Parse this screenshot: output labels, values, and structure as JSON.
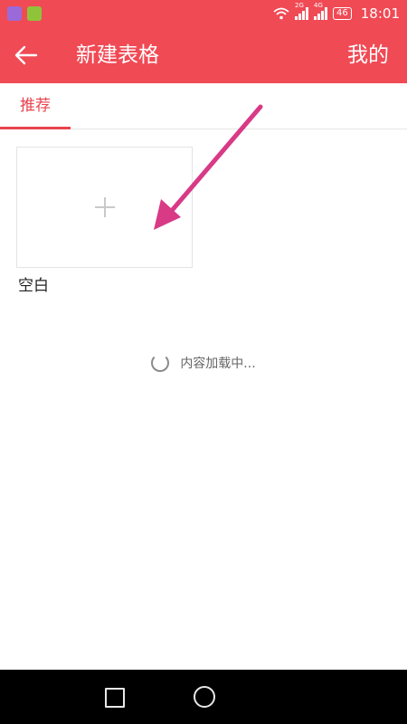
{
  "status_bar": {
    "signal_2g_label": "2G",
    "signal_4g_label": "4G",
    "battery": "46",
    "time": "18:01"
  },
  "app_bar": {
    "title": "新建表格",
    "mine_label": "我的"
  },
  "tabs": [
    {
      "label": "推荐",
      "active": true
    }
  ],
  "templates": [
    {
      "label": "空白"
    }
  ],
  "loading_text": "内容加载中...",
  "colors": {
    "accent": "#f04a55",
    "tab_active": "#e8434f",
    "annotation_arrow": "#d83a86"
  },
  "icons": {
    "back": "arrow-left-icon",
    "add": "plus-icon",
    "loading": "spinner-icon",
    "recent_apps": "square-icon",
    "home": "circle-icon"
  }
}
